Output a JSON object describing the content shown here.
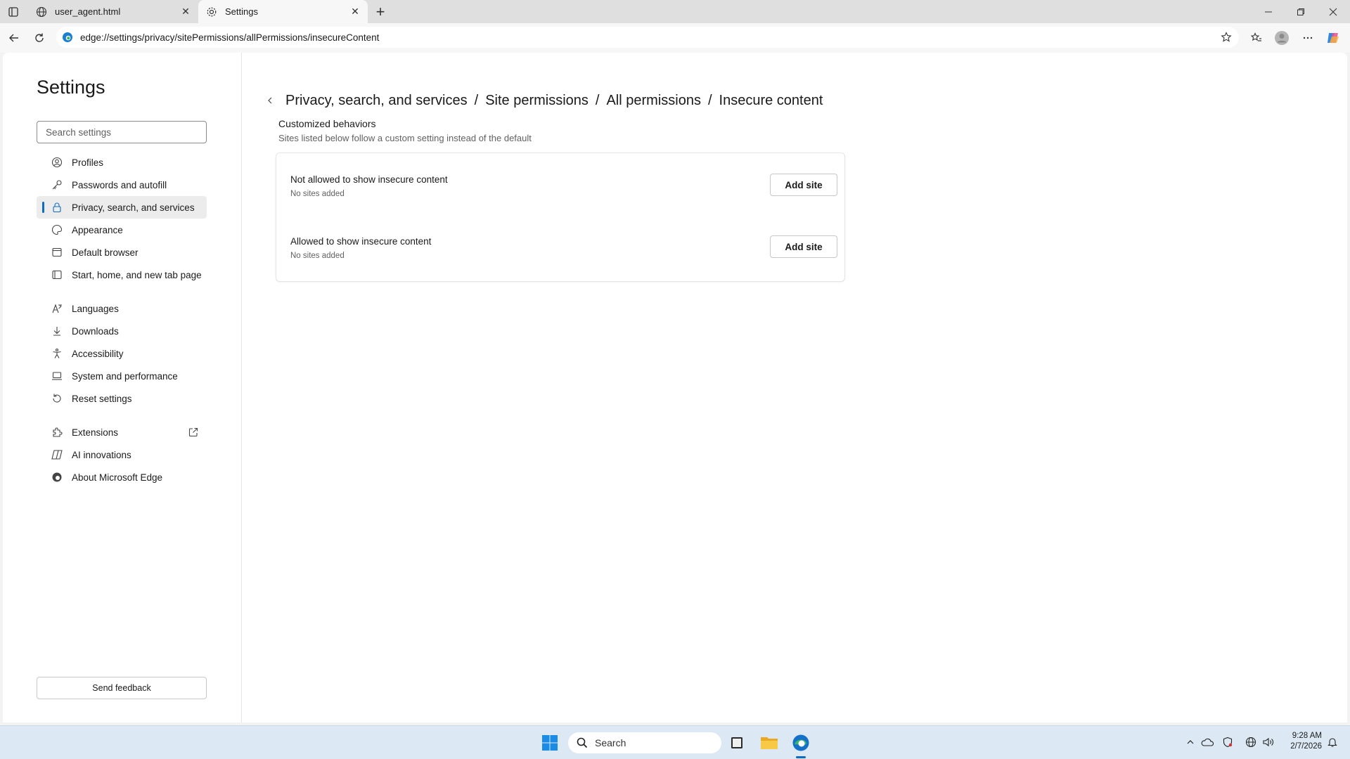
{
  "browser": {
    "tabs": [
      {
        "title": "user_agent.html",
        "active": false
      },
      {
        "title": "Settings",
        "active": true
      }
    ],
    "url": "edge://settings/privacy/sitePermissions/allPermissions/insecureContent"
  },
  "sidebar": {
    "title": "Settings",
    "search_placeholder": "Search settings",
    "items": [
      {
        "label": "Profiles",
        "icon": "profile-icon"
      },
      {
        "label": "Passwords and autofill",
        "icon": "key-icon"
      },
      {
        "label": "Privacy, search, and services",
        "icon": "lock-icon",
        "selected": true
      },
      {
        "label": "Appearance",
        "icon": "appearance-icon"
      },
      {
        "label": "Default browser",
        "icon": "browser-icon"
      },
      {
        "label": "Start, home, and new tab page",
        "icon": "home-icon"
      },
      {
        "label": "Languages",
        "icon": "languages-icon"
      },
      {
        "label": "Downloads",
        "icon": "download-icon"
      },
      {
        "label": "Accessibility",
        "icon": "accessibility-icon"
      },
      {
        "label": "System and performance",
        "icon": "laptop-icon"
      },
      {
        "label": "Reset settings",
        "icon": "reset-icon"
      },
      {
        "label": "Extensions",
        "icon": "puzzle-icon"
      },
      {
        "label": "AI innovations",
        "icon": "ai-icon"
      },
      {
        "label": "About Microsoft Edge",
        "icon": "edge-icon"
      }
    ],
    "feedback_label": "Send feedback"
  },
  "main": {
    "breadcrumbs": [
      "Privacy, search, and services",
      "Site permissions",
      "All permissions",
      "Insecure content"
    ],
    "breadcrumb_separator": "/",
    "section_title": "Customized behaviors",
    "section_subtitle": "Sites listed below follow a custom setting instead of the default",
    "rows": [
      {
        "title": "Not allowed to show insecure content",
        "subtitle": "No sites added",
        "button": "Add site"
      },
      {
        "title": "Allowed to show insecure content",
        "subtitle": "No sites added",
        "button": "Add site"
      }
    ]
  },
  "taskbar": {
    "search_placeholder": "Search",
    "time": "9:28 AM",
    "date": "2/7/2026"
  },
  "colors": {
    "accent": "#0f6cbd",
    "taskbar": "#dce8f3"
  }
}
